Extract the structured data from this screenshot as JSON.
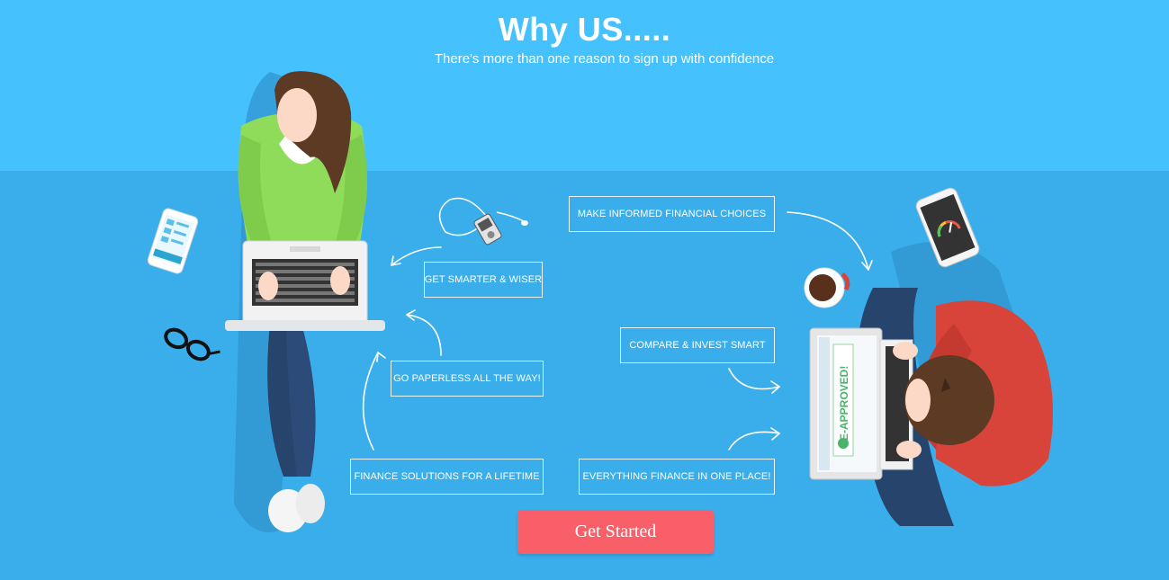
{
  "header": {
    "title": "Why US.....",
    "subtitle": "There's more than one reason to sign up with confidence"
  },
  "features": [
    {
      "id": "make-informed-financial-choices",
      "label": "MAKE INFORMED FINANCIAL CHOICES"
    },
    {
      "id": "get-smarter-wiser",
      "label": "GET SMARTER & WISER"
    },
    {
      "id": "compare-invest-smart",
      "label": "COMPARE & INVEST SMART"
    },
    {
      "id": "go-paperless",
      "label": "GO PAPERLESS ALL THE WAY!"
    },
    {
      "id": "finance-solutions-lifetime",
      "label": "FINANCE SOLUTIONS FOR A LIFETIME"
    },
    {
      "id": "everything-finance-one-place",
      "label": "EVERYTHING FINANCE IN ONE PLACE!"
    }
  ],
  "illustration": {
    "laptop_screen_text": "E-APPROVED!",
    "icons": [
      "woman-laptop-illustration",
      "man-laptop-illustration",
      "smartphone-icon",
      "glasses-icon",
      "mp3-player-icon",
      "coffee-cup-icon",
      "speedometer-phone-icon",
      "curved-arrow-icon"
    ]
  },
  "cta": {
    "label": "Get Started"
  },
  "colors": {
    "background_top": "#45c2fd",
    "background_bottom": "#3aaeea",
    "cta": "#f85f68",
    "woman_sweater": "#8fdc5a",
    "man_sweater": "#d9443a"
  }
}
